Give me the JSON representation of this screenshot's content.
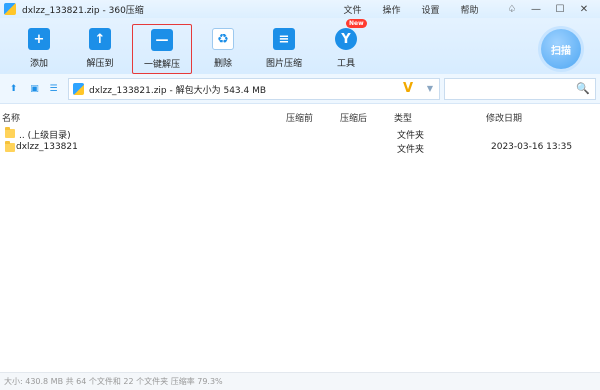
{
  "window": {
    "title": "dxlzz_133821.zip - 360压缩",
    "menu": [
      "文件",
      "操作",
      "设置",
      "帮助"
    ],
    "controls": {
      "skin": "♤",
      "minimize": "—",
      "maximize": "☐",
      "close": "✕"
    }
  },
  "toolbar": {
    "items": [
      {
        "label": "添加",
        "icon": "add-icon",
        "glyph": "+"
      },
      {
        "label": "解压到",
        "icon": "extract-to-icon",
        "glyph": "↑"
      },
      {
        "label": "一键解压",
        "icon": "one-click-extract-icon",
        "glyph": "—"
      },
      {
        "label": "删除",
        "icon": "recycle-icon",
        "glyph": "♻"
      },
      {
        "label": "图片压缩",
        "icon": "image-compress-icon",
        "glyph": "≡"
      },
      {
        "label": "工具",
        "icon": "tools-icon",
        "glyph": "Y"
      }
    ],
    "new_badge": "New",
    "scan_label": "扫描"
  },
  "address": {
    "up_glyph": "⬆",
    "view_glyph": "▣",
    "list_glyph": "☰",
    "path": "dxlzz_133821.zip - 解包大小为 543.4 MB",
    "v_glyph": "V",
    "dropdown_glyph": "▼",
    "search_glyph": "🔍"
  },
  "table": {
    "headers": [
      "名称",
      "压缩前",
      "压缩后",
      "类型",
      "修改日期"
    ],
    "rows": [
      {
        "name": ".. (上级目录)",
        "type": "文件夹",
        "date": ""
      },
      {
        "name": "dxlzz_133821",
        "type": "文件夹",
        "date": "2023-03-16 13:35"
      }
    ]
  },
  "status": "大小: 430.8 MB 共 64 个文件和 22 个文件夹 压缩率 79.3%",
  "colors": {
    "accent": "#1c8fe8",
    "highlight": "#e63a3a",
    "folder": "#ffd35a"
  }
}
